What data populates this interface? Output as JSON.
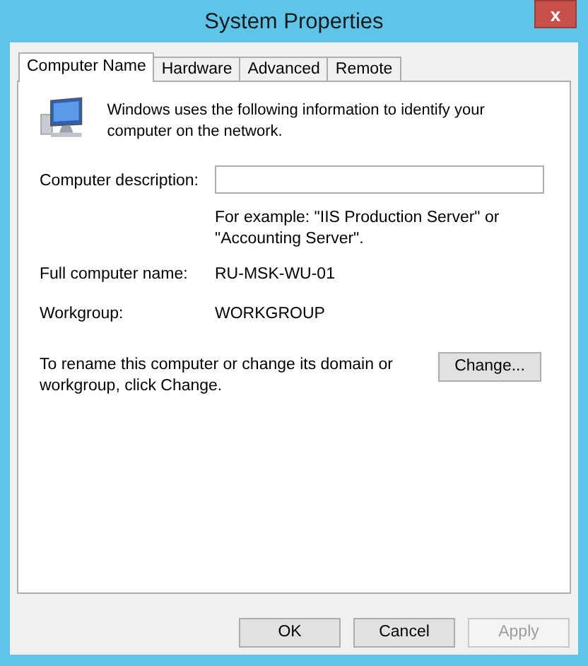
{
  "window": {
    "title": "System Properties",
    "close": "x"
  },
  "tabs": [
    {
      "label": "Computer Name",
      "selected": true
    },
    {
      "label": "Hardware",
      "selected": false
    },
    {
      "label": "Advanced",
      "selected": false
    },
    {
      "label": "Remote",
      "selected": false
    }
  ],
  "intro": "Windows uses the following information to identify your computer on the network.",
  "description": {
    "label": "Computer description:",
    "hint": "For example: \"IIS Production Server\" or \"Accounting Server\"."
  },
  "fields": [
    {
      "label": "Full computer name:",
      "value": "RU-MSK-WU-01"
    },
    {
      "label": "Workgroup:",
      "value": "WORKGROUP"
    }
  ],
  "rename": {
    "text": "To rename this computer or change its domain or workgroup, click Change.",
    "button": "Change..."
  },
  "buttons": [
    {
      "label": "OK",
      "disabled": false
    },
    {
      "label": "Cancel",
      "disabled": false
    },
    {
      "label": "Apply",
      "disabled": true
    }
  ]
}
